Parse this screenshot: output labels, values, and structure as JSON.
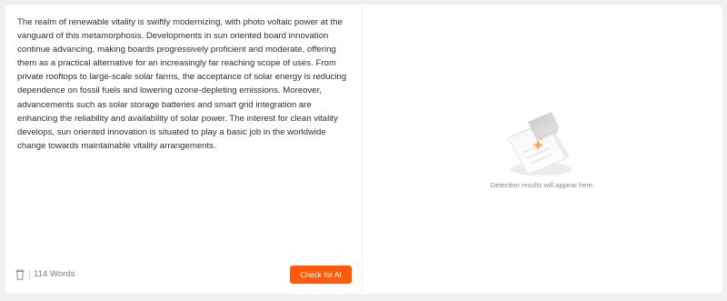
{
  "editor": {
    "text": "The realm of renewable vitality is swiftly modernizing, with photo voltaic power at the vanguard of this metamorphosis. Developments in sun oriented board innovation continue advancing, making boards progressively proficient and moderate, offering them as a practical alternative for an increasingly far reaching scope of uses. From private rooftops to large-scale solar farms, the acceptance of solar energy is reducing dependence on fossil fuels and lowering ozone-depleting emissions. Moreover, advancements such as solar storage batteries and smart grid integration are enhancing the reliability and availability of solar power. The interest for clean vitality develops, sun oriented innovation is situated to play a basic job in the worldwide change towards maintainable vitality arrangements.",
    "word_count": "114 Words",
    "check_button": "Check for AI",
    "delete_icon": "trash-icon"
  },
  "results": {
    "placeholder": "Detection results will appear here.",
    "illustration_icon": "document-scan-illustration"
  },
  "colors": {
    "accent": "#ff5a0a",
    "page_background": "#f0f0f2",
    "card_background": "#ffffff"
  }
}
